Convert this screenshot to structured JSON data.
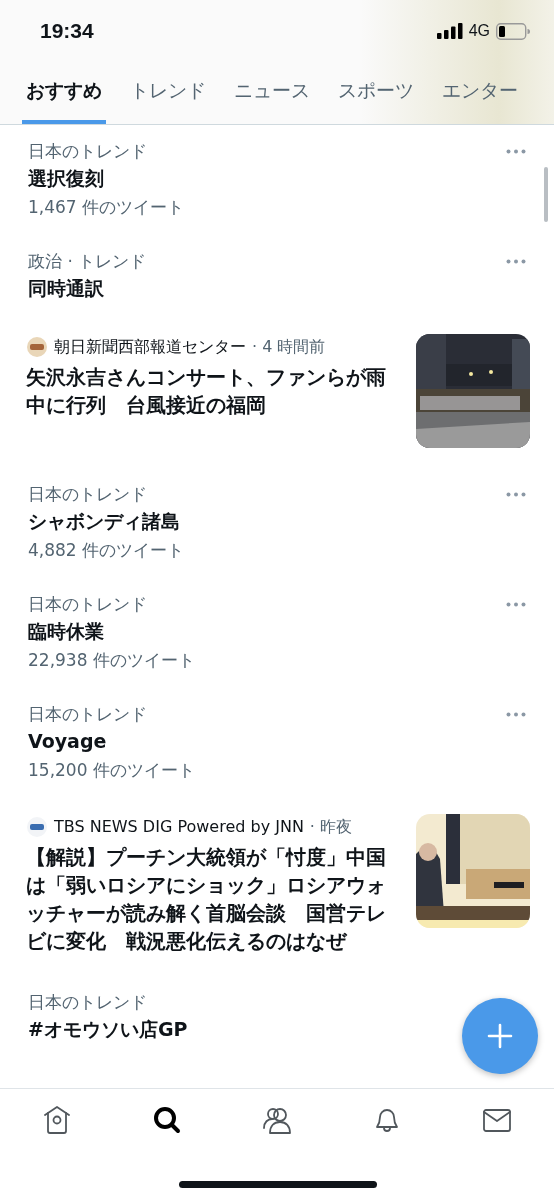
{
  "status_bar": {
    "time": "19:34",
    "network": "4G"
  },
  "tabs": [
    {
      "label": "おすすめ",
      "selected": true
    },
    {
      "label": "トレンド",
      "selected": false
    },
    {
      "label": "ニュース",
      "selected": false
    },
    {
      "label": "スポーツ",
      "selected": false
    },
    {
      "label": "エンター",
      "selected": false
    }
  ],
  "items": [
    {
      "kind": "trend",
      "category": "日本のトレンド",
      "title": "選択復刻",
      "count": "1,467 件のツイート",
      "menu": true
    },
    {
      "kind": "trend",
      "category": "政治 · トレンド",
      "title": "同時通訳",
      "menu": true
    },
    {
      "kind": "news",
      "source": "朝日新聞西部報道センター",
      "time": "· 4 時間前",
      "headline": "矢沢永吉さんコンサート、ファンらが雨中に行列　台風接近の福岡"
    },
    {
      "kind": "trend",
      "category": "日本のトレンド",
      "title": "シャボンディ諸島",
      "count": "4,882 件のツイート",
      "menu": true
    },
    {
      "kind": "trend",
      "category": "日本のトレンド",
      "title": "臨時休業",
      "count": "22,938 件のツイート",
      "menu": true
    },
    {
      "kind": "trend",
      "category": "日本のトレンド",
      "title": "Voyage",
      "count": "15,200 件のツイート",
      "menu": true
    },
    {
      "kind": "news",
      "source": "TBS NEWS DIG Powered by JNN",
      "time": "· 昨夜",
      "headline": "【解説】プーチン大統領が「忖度」中国は「弱いロシアにショック」ロシアウォッチャーが読み解く首脳会談　国営テレビに変化　戦況悪化伝えるのはなぜ"
    },
    {
      "kind": "trend",
      "category": "日本のトレンド",
      "title": "#オモウソい店GP",
      "menu": false
    }
  ],
  "nav": [
    {
      "selected": false
    },
    {
      "selected": true
    },
    {
      "selected": false
    },
    {
      "selected": false
    },
    {
      "selected": false
    }
  ]
}
